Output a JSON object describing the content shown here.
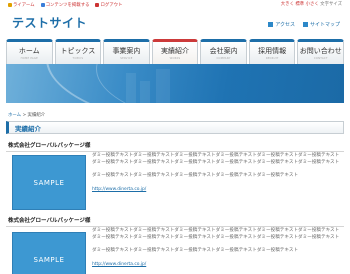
{
  "toplinks": [
    {
      "label": "ライアーム",
      "color": "#e0a000"
    },
    {
      "label": "コンテンツを掲載する",
      "color": "#3b7dd8"
    },
    {
      "label": "ログアウト",
      "color": "#cc3333"
    }
  ],
  "fontsize": {
    "label": "文字サイズ",
    "options": [
      "大きく",
      "標準",
      "小さく"
    ]
  },
  "site_title": "テストサイト",
  "util": {
    "access": "アクセス",
    "sitemap": "サイトマップ"
  },
  "nav": [
    {
      "label": "ホーム",
      "sub": "HOME PAGE"
    },
    {
      "label": "トピックス",
      "sub": "TOPICS"
    },
    {
      "label": "事業案内",
      "sub": "SERVICE"
    },
    {
      "label": "実績紹介",
      "sub": "WORKS"
    },
    {
      "label": "会社案内",
      "sub": "COMPANY"
    },
    {
      "label": "採用情報",
      "sub": "RECRUIT"
    },
    {
      "label": "お問い合わせ",
      "sub": "CONTACT"
    }
  ],
  "breadcrumb": {
    "home": "ホーム",
    "sep": ">",
    "current": "実績紹介"
  },
  "heading": "実績紹介",
  "companies": [
    {
      "name": "株式会社グローバルパッケージ様",
      "sample": "SAMPLE",
      "para1": "ダミー投稿テキストダミー投稿テキストダミー投稿テキストダミー投稿テキストダミー投稿テキストダミー投稿テキストダミー投稿テキストダミー投稿テキストダミー投稿テキストダミー投稿テキストダミー投稿テキストダミー投稿テキスト",
      "para2": "ダミー投稿テキストダミー投稿テキストダミー投稿テキストダミー投稿テキストダミー投稿テキスト",
      "url": "http://www.dinerta.co.jp/"
    },
    {
      "name": "株式会社グローバルパッケージ様",
      "sample": "SAMPLE",
      "para1": "ダミー投稿テキストダミー投稿テキストダミー投稿テキストダミー投稿テキストダミー投稿テキストダミー投稿テキストダミー投稿テキストダミー投稿テキストダミー投稿テキストダミー投稿テキストダミー投稿テキストダミー投稿テキスト",
      "para2": "ダミー投稿テキストダミー投稿テキストダミー投稿テキストダミー投稿テキストダミー投稿テキスト",
      "url": "http://www.dinerta.co.jp/"
    }
  ]
}
